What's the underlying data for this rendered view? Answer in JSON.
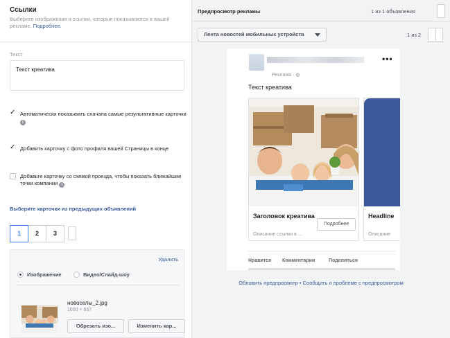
{
  "links_section": {
    "title": "Ссылки",
    "description": "Выберите изображения и ссылки, которые показываются в вашей рекламе.",
    "more_link": "Подробнее."
  },
  "text_field": {
    "label": "Текст",
    "value": "Текст креатива"
  },
  "options": [
    {
      "label": "Автоматически показывать сначала самые результативные карточки",
      "checked": true
    },
    {
      "label": "Добавить карточку с фото профиля вашей Страницы в конце",
      "checked": true
    },
    {
      "label": "Добавьте карточку со схемой проезда, чтобы показать ближайшие точки компании",
      "checked": false
    }
  ],
  "previous_cards_link": "Выберите карточки из предыдущих объявлений",
  "card_tabs": [
    "1",
    "2",
    "3"
  ],
  "card_editor": {
    "delete_label": "Удалить",
    "media_options": [
      "Изображение",
      "Видео/Слайд-шоу"
    ],
    "file_name": "новоселы_2.jpg",
    "file_dims": "1000 × 667",
    "crop_button": "Обрезать изо...",
    "change_button": "Изменить кар..."
  },
  "preview": {
    "title": "Предпросмотр рекламы",
    "ad_count": "1 из 1 объявления",
    "placement": "Лента новостей мобильных устройств",
    "page_count": "1 из 2",
    "sponsored": "Реклама · ",
    "ad_text": "Текст креатива",
    "card1": {
      "headline": "Заголовок креатива",
      "description": "Описание ссылки в ...",
      "cta": "Подробнее"
    },
    "card2": {
      "headline": "Headline",
      "description": "Описание"
    },
    "actions": [
      "Нравится",
      "Комментарии",
      "Поделиться"
    ],
    "refresh_link": "Обновить предпросмотр",
    "separator": " • ",
    "report_link": "Сообщить о проблеме с предпросмотром"
  }
}
